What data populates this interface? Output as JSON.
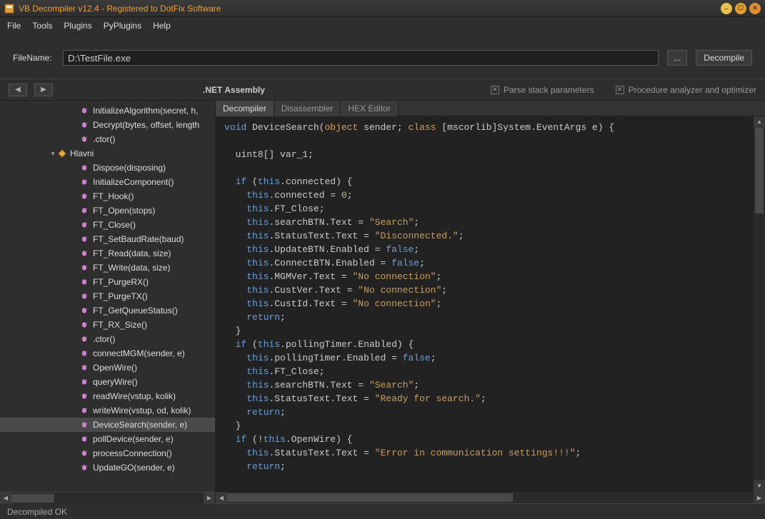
{
  "title": "VB Decompiler v12.4 - Registered to DotFix Software",
  "menu": {
    "file": "File",
    "tools": "Tools",
    "plugins": "Plugins",
    "pyplugins": "PyPlugins",
    "help": "Help"
  },
  "filerow": {
    "label": "FileName:",
    "value": "D:\\TestFile.exe",
    "browse": "...",
    "decompile": "Decompile"
  },
  "infobar": {
    "assembly_title": ".NET Assembly",
    "chk1": "Parse stack parameters",
    "chk2": "Procedure analyzer and optimizer"
  },
  "tree": {
    "items": [
      {
        "indent": 96,
        "icon": "method",
        "label": "InitializeAlgorithm(secret, h,"
      },
      {
        "indent": 96,
        "icon": "method",
        "label": "Decrypt(bytes, offset, length"
      },
      {
        "indent": 96,
        "icon": "method",
        "label": ".ctor()"
      },
      {
        "indent": 64,
        "toggle": "▾",
        "icon": "class",
        "label": "Hlavni"
      },
      {
        "indent": 96,
        "icon": "method",
        "label": "Dispose(disposing)"
      },
      {
        "indent": 96,
        "icon": "method",
        "label": "InitializeComponent()"
      },
      {
        "indent": 96,
        "icon": "method",
        "label": "FT_Hook()"
      },
      {
        "indent": 96,
        "icon": "method",
        "label": "FT_Open(stops)"
      },
      {
        "indent": 96,
        "icon": "method",
        "label": "FT_Close()"
      },
      {
        "indent": 96,
        "icon": "method",
        "label": "FT_SetBaudRate(baud)"
      },
      {
        "indent": 96,
        "icon": "method",
        "label": "FT_Read(data, size)"
      },
      {
        "indent": 96,
        "icon": "method",
        "label": "FT_Write(data, size)"
      },
      {
        "indent": 96,
        "icon": "method",
        "label": "FT_PurgeRX()"
      },
      {
        "indent": 96,
        "icon": "method",
        "label": "FT_PurgeTX()"
      },
      {
        "indent": 96,
        "icon": "method",
        "label": "FT_GetQueueStatus()"
      },
      {
        "indent": 96,
        "icon": "method",
        "label": "FT_RX_Size()"
      },
      {
        "indent": 96,
        "icon": "method",
        "label": ".ctor()"
      },
      {
        "indent": 96,
        "icon": "method",
        "label": "connectMGM(sender, e)"
      },
      {
        "indent": 96,
        "icon": "method",
        "label": "OpenWire()"
      },
      {
        "indent": 96,
        "icon": "method",
        "label": "queryWire()"
      },
      {
        "indent": 96,
        "icon": "method",
        "label": "readWire(vstup, kolik)"
      },
      {
        "indent": 96,
        "icon": "method",
        "label": "writeWire(vstup, od, kolik)"
      },
      {
        "indent": 96,
        "icon": "method",
        "label": "DeviceSearch(sender, e)",
        "selected": true
      },
      {
        "indent": 96,
        "icon": "method",
        "label": "pollDevice(sender, e)"
      },
      {
        "indent": 96,
        "icon": "method",
        "label": "processConnection()"
      },
      {
        "indent": 96,
        "icon": "method",
        "label": "UpdateGO(sender, e)"
      }
    ]
  },
  "tabs": {
    "decompiler": "Decompiler",
    "disassembler": "Disassembler",
    "hexeditor": "HEX Editor"
  },
  "code": [
    [
      [
        "kw",
        "void"
      ],
      [
        "id",
        " DeviceSearch("
      ],
      [
        "type",
        "object"
      ],
      [
        "id",
        " sender; "
      ],
      [
        "type",
        "class"
      ],
      [
        "id",
        " [mscorlib]System.EventArgs e) {"
      ]
    ],
    [],
    [
      [
        "id",
        "  uint8[] var_1;"
      ]
    ],
    [],
    [
      [
        "id",
        "  "
      ],
      [
        "kw",
        "if"
      ],
      [
        "id",
        " ("
      ],
      [
        "kw",
        "this"
      ],
      [
        "id",
        ".connected) {"
      ]
    ],
    [
      [
        "id",
        "    "
      ],
      [
        "kw",
        "this"
      ],
      [
        "id",
        ".connected = "
      ],
      [
        "num",
        "0"
      ],
      [
        "id",
        ";"
      ]
    ],
    [
      [
        "id",
        "    "
      ],
      [
        "kw",
        "this"
      ],
      [
        "id",
        ".FT_Close;"
      ]
    ],
    [
      [
        "id",
        "    "
      ],
      [
        "kw",
        "this"
      ],
      [
        "id",
        ".searchBTN.Text = "
      ],
      [
        "str",
        "\"Search\""
      ],
      [
        "id",
        ";"
      ]
    ],
    [
      [
        "id",
        "    "
      ],
      [
        "kw",
        "this"
      ],
      [
        "id",
        ".StatusText.Text = "
      ],
      [
        "str",
        "\"Disconnected.\""
      ],
      [
        "id",
        ";"
      ]
    ],
    [
      [
        "id",
        "    "
      ],
      [
        "kw",
        "this"
      ],
      [
        "id",
        ".UpdateBTN.Enabled = "
      ],
      [
        "kw",
        "false"
      ],
      [
        "id",
        ";"
      ]
    ],
    [
      [
        "id",
        "    "
      ],
      [
        "kw",
        "this"
      ],
      [
        "id",
        ".ConnectBTN.Enabled = "
      ],
      [
        "kw",
        "false"
      ],
      [
        "id",
        ";"
      ]
    ],
    [
      [
        "id",
        "    "
      ],
      [
        "kw",
        "this"
      ],
      [
        "id",
        ".MGMVer.Text = "
      ],
      [
        "str",
        "\"No connection\""
      ],
      [
        "id",
        ";"
      ]
    ],
    [
      [
        "id",
        "    "
      ],
      [
        "kw",
        "this"
      ],
      [
        "id",
        ".CustVer.Text = "
      ],
      [
        "str",
        "\"No connection\""
      ],
      [
        "id",
        ";"
      ]
    ],
    [
      [
        "id",
        "    "
      ],
      [
        "kw",
        "this"
      ],
      [
        "id",
        ".CustId.Text = "
      ],
      [
        "str",
        "\"No connection\""
      ],
      [
        "id",
        ";"
      ]
    ],
    [
      [
        "id",
        "    "
      ],
      [
        "kw",
        "return"
      ],
      [
        "id",
        ";"
      ]
    ],
    [
      [
        "id",
        "  }"
      ]
    ],
    [
      [
        "id",
        "  "
      ],
      [
        "kw",
        "if"
      ],
      [
        "id",
        " ("
      ],
      [
        "kw",
        "this"
      ],
      [
        "id",
        ".pollingTimer.Enabled) {"
      ]
    ],
    [
      [
        "id",
        "    "
      ],
      [
        "kw",
        "this"
      ],
      [
        "id",
        ".pollingTimer.Enabled = "
      ],
      [
        "kw",
        "false"
      ],
      [
        "id",
        ";"
      ]
    ],
    [
      [
        "id",
        "    "
      ],
      [
        "kw",
        "this"
      ],
      [
        "id",
        ".FT_Close;"
      ]
    ],
    [
      [
        "id",
        "    "
      ],
      [
        "kw",
        "this"
      ],
      [
        "id",
        ".searchBTN.Text = "
      ],
      [
        "str",
        "\"Search\""
      ],
      [
        "id",
        ";"
      ]
    ],
    [
      [
        "id",
        "    "
      ],
      [
        "kw",
        "this"
      ],
      [
        "id",
        ".StatusText.Text = "
      ],
      [
        "str",
        "\"Ready for search.\""
      ],
      [
        "id",
        ";"
      ]
    ],
    [
      [
        "id",
        "    "
      ],
      [
        "kw",
        "return"
      ],
      [
        "id",
        ";"
      ]
    ],
    [
      [
        "id",
        "  }"
      ]
    ],
    [
      [
        "id",
        "  "
      ],
      [
        "kw",
        "if"
      ],
      [
        "id",
        " (!"
      ],
      [
        "kw",
        "this"
      ],
      [
        "id",
        ".OpenWire) {"
      ]
    ],
    [
      [
        "id",
        "    "
      ],
      [
        "kw",
        "this"
      ],
      [
        "id",
        ".StatusText.Text = "
      ],
      [
        "str",
        "\"Error in communication settings!!!\""
      ],
      [
        "id",
        ";"
      ]
    ],
    [
      [
        "id",
        "    "
      ],
      [
        "kw",
        "return"
      ],
      [
        "id",
        ";"
      ]
    ]
  ],
  "status": "Decompiled OK"
}
